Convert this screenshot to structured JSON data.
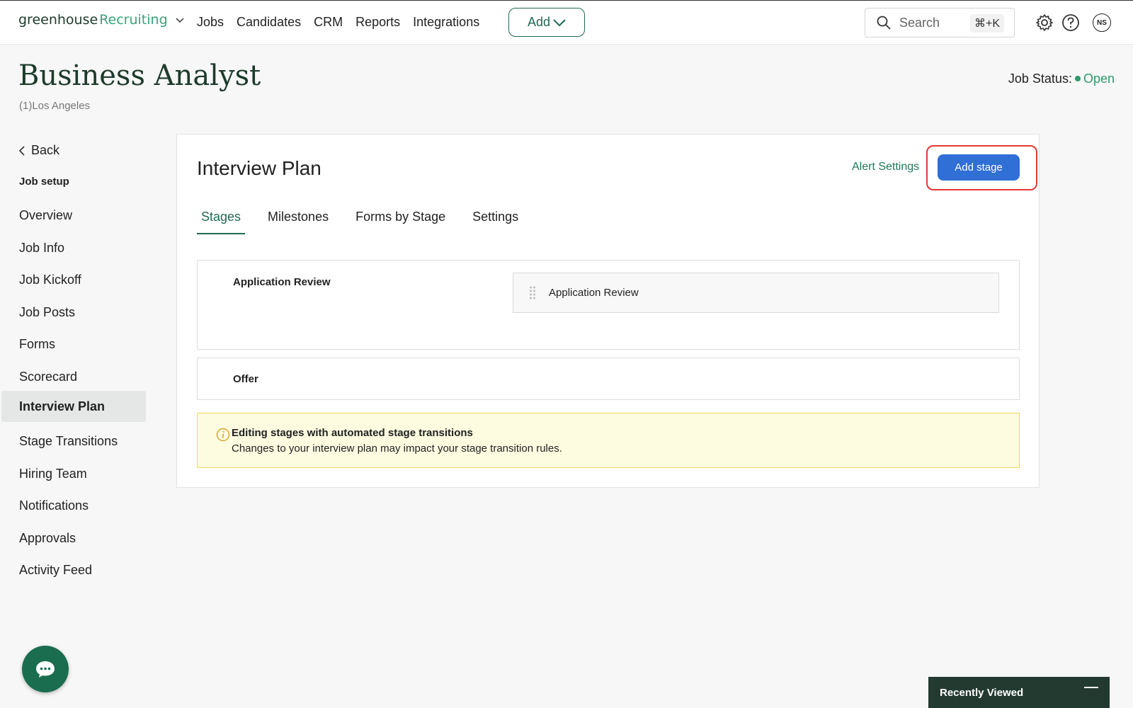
{
  "topnav": {
    "logo_brand": "greenhouse",
    "logo_product": "Recruiting",
    "links": [
      "Jobs",
      "Candidates",
      "CRM",
      "Reports",
      "Integrations"
    ],
    "add_label": "Add",
    "search_placeholder": "Search",
    "search_shortcut": "⌘+K",
    "avatar_initials": "NS"
  },
  "header": {
    "title": "Business Analyst",
    "location": "(1)Los Angeles",
    "status_label": "Job Status:",
    "status_value": "Open",
    "status_color": "#2f9a6b"
  },
  "sidebar": {
    "back_label": "Back",
    "section_heading": "Job setup",
    "items": [
      {
        "label": "Overview",
        "active": false
      },
      {
        "label": "Job Info",
        "active": false
      },
      {
        "label": "Job Kickoff",
        "active": false
      },
      {
        "label": "Job Posts",
        "active": false
      },
      {
        "label": "Forms",
        "active": false
      },
      {
        "label": "Scorecard",
        "active": false
      },
      {
        "label": "Interview Plan",
        "active": true
      },
      {
        "label": "Stage Transitions",
        "active": false
      },
      {
        "label": "Hiring Team",
        "active": false
      },
      {
        "label": "Notifications",
        "active": false
      },
      {
        "label": "Approvals",
        "active": false
      },
      {
        "label": "Activity Feed",
        "active": false
      }
    ]
  },
  "main": {
    "title": "Interview Plan",
    "alert_settings_label": "Alert Settings",
    "add_stage_label": "Add stage",
    "tabs": [
      {
        "label": "Stages",
        "active": true
      },
      {
        "label": "Milestones",
        "active": false
      },
      {
        "label": "Forms by Stage",
        "active": false
      },
      {
        "label": "Settings",
        "active": false
      }
    ],
    "stages": [
      {
        "name": "Application Review",
        "sub_stages": [
          "Application Review"
        ]
      },
      {
        "name": "Offer",
        "sub_stages": []
      }
    ],
    "banner": {
      "title": "Editing stages with automated stage transitions",
      "body": "Changes to your interview plan may impact your stage transition rules."
    }
  },
  "recently_viewed": {
    "label": "Recently Viewed"
  },
  "colors": {
    "brand_green": "#1e6b4f",
    "primary_blue": "#2f6fd6",
    "highlight_red": "#e53935",
    "banner_bg": "#fdfbe0"
  }
}
